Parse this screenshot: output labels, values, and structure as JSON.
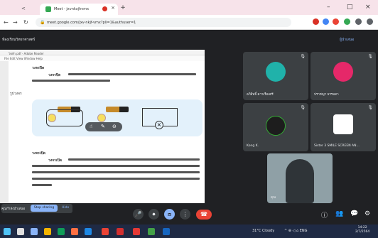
{
  "browser": {
    "prev_tab_label": "<",
    "active_tab_title": "Meet - jxvnkxjhvmx",
    "new_tab_symbol": "+",
    "close_symbol": "×",
    "url": "meet.google.com/jxv-nkjf-vmx?pli=1&authuser=1",
    "window_minimize": "–",
    "window_maximize": "□",
    "window_close": "×",
    "nav_back": "←",
    "nav_forward": "→",
    "nav_reload": "↻"
  },
  "meet": {
    "header_left": "ห้องเรียนวิทยาศาสตร์",
    "header_right": "ผู้นำเสนอ"
  },
  "document": {
    "window_title": "ไฟฟ้า.pdf - Adobe Reader",
    "menu": "File Edit View Window Help",
    "section1_heading": "วงจรปิด",
    "section1_lead": "วงจรปิด",
    "section2_heading": "วงจรเปิด",
    "section2_lead": "วงจรเปิด",
    "left_note": "รูปวงจร"
  },
  "participants": [
    {
      "name": "อภิสิทธิ์ ดาวเรืองศรี",
      "initial": "",
      "color": "#20b2aa"
    },
    {
      "name": "ปราชญา ธรรมดา",
      "initial": "",
      "color": "#e52869"
    },
    {
      "name": "Kong K.",
      "initial": "",
      "color": "#1d1d1d"
    },
    {
      "name": "Sister 3 SMILE SCREEN AN...",
      "initial": "",
      "color": "#ffffff"
    },
    {
      "name": "คุณ",
      "initial": "",
      "color": "#6c7a80"
    }
  ],
  "sharing": {
    "label": "คุณกำลังนำเสนอ",
    "stop_label": "Stop sharing",
    "hide_label": "Hide"
  },
  "controls": {
    "mic": "🎤",
    "camera": "⏺",
    "present": "⧈",
    "more": "⋮",
    "end": "☎",
    "info": "ⓘ",
    "people": "👥",
    "chat": "💬",
    "activities": "⚙"
  },
  "taskbar": {
    "weather": "31°C Cloudy",
    "tray": "^ ⊕ ◁ ⌂ ENG",
    "time": "14:22",
    "date": "2/7/2564"
  },
  "colors": {
    "tab_bar": "#f7e3ea",
    "meet_bg": "#202124",
    "tile_bg": "#3c4043",
    "accent": "#8ab4f8",
    "end_call": "#ea4335",
    "taskbar": "#1f2a44"
  }
}
